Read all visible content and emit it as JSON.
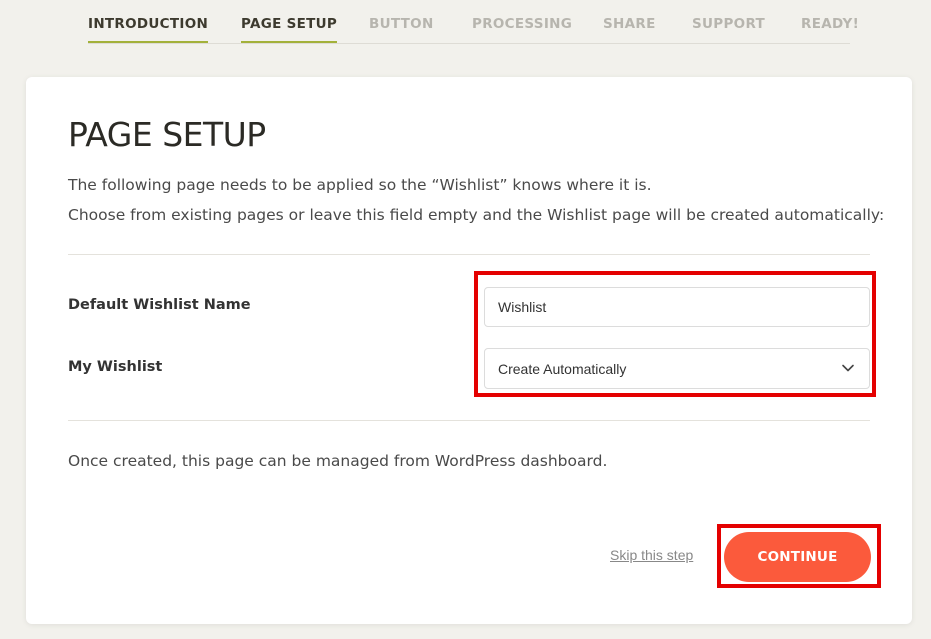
{
  "wizard": {
    "steps": [
      {
        "label": "INTRODUCTION",
        "state": "done"
      },
      {
        "label": "PAGE SETUP",
        "state": "active"
      },
      {
        "label": "BUTTON",
        "state": "pending"
      },
      {
        "label": "PROCESSING",
        "state": "pending"
      },
      {
        "label": "SHARE",
        "state": "pending"
      },
      {
        "label": "SUPPORT",
        "state": "pending"
      },
      {
        "label": "READY!",
        "state": "pending"
      }
    ],
    "accent_color": "#a3b13a"
  },
  "card": {
    "title": "PAGE SETUP",
    "description_line1": "The following page needs to be applied so the “Wishlist” knows where it is.",
    "description_line2": "Choose from existing pages or leave this field empty and the Wishlist page will be created automatically:",
    "fields": {
      "wishlist_name": {
        "label": "Default Wishlist Name",
        "value": "Wishlist"
      },
      "my_wishlist": {
        "label": "My Wishlist",
        "selected": "Create Automatically"
      }
    },
    "note": "Once created, this page can be managed from WordPress dashboard.",
    "skip_label": "Skip this step",
    "continue_label": "CONTINUE",
    "button_color": "#fb5a3c",
    "highlight_color": "#e40000"
  }
}
